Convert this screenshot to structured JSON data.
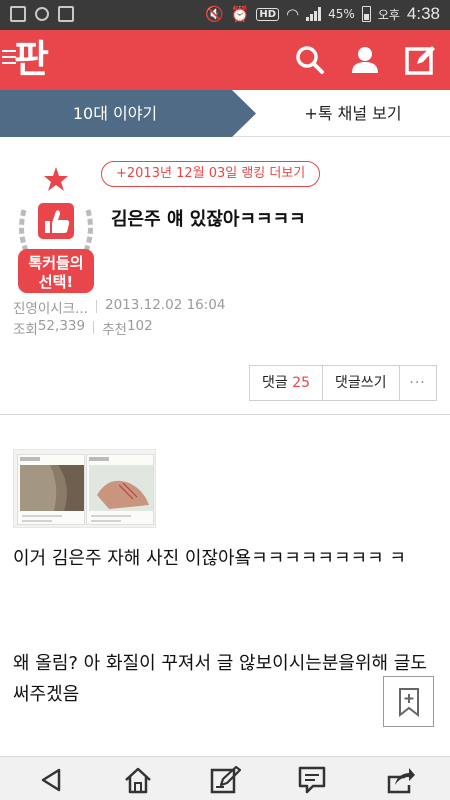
{
  "status_bar": {
    "battery": "45%",
    "ampm": "오후",
    "time": "4:38",
    "hd": "HD"
  },
  "app": {
    "logo": "판",
    "accent_color": "#e8464a",
    "icons": [
      "menu-icon",
      "search-icon",
      "user-icon",
      "write-icon"
    ]
  },
  "tabs": {
    "active": "10대 이야기",
    "secondary": "+톡 채널 보기"
  },
  "post": {
    "badge_text_1": "톡커들의",
    "badge_text_2": "선택!",
    "ranking_link": "+2013년 12월 03일 랭킹 더보기",
    "title": "김은주 얘 있잖아ㅋㅋㅋㅋ",
    "author": "진영이시크...",
    "date": "2013.12.02 16:04",
    "views_label": "조회",
    "views": "52,339",
    "likes_label": "추천",
    "likes": "102"
  },
  "actions": {
    "comments_label": "댓글",
    "comments_count": "25",
    "write_comment": "댓글쓰기",
    "more": "···"
  },
  "body": {
    "paragraph1": " 이거 김은주 자해 사진 이잖아욬ㅋㅋㅋㅋㅋㅋㅋㅋ ㅋ",
    "paragraph2": "왜 올림? 아 화질이 꾸져서 글 않보이시는분을위해 글도 써주겠음"
  },
  "bottom_nav": {
    "items": [
      "back-icon",
      "home-icon",
      "edit-icon",
      "comment-icon",
      "share-icon"
    ]
  }
}
